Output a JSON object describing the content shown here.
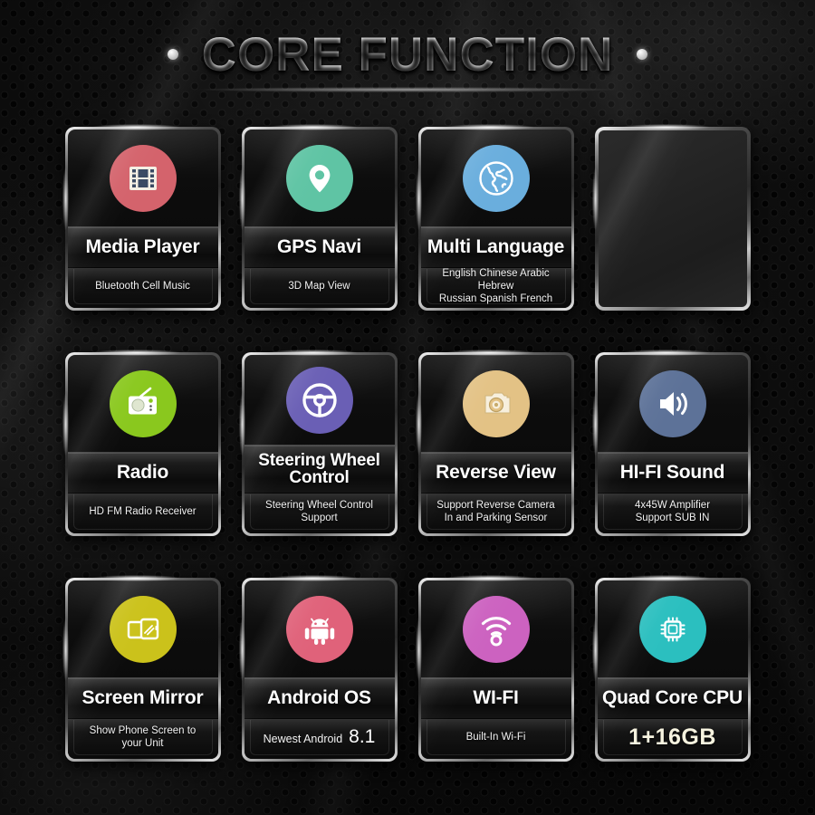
{
  "header": {
    "title": "CORE FUNCTION",
    "left_dot": "dot-decoration",
    "right_dot": "dot-decoration"
  },
  "cards": [
    {
      "id": "media-player",
      "title": "Media Player",
      "subtitle": "Bluetooth Cell Music",
      "icon": "film-strip-icon",
      "icon_color": "#d4636c",
      "title_lines": 1,
      "empty": false
    },
    {
      "id": "gps-navi",
      "title": "GPS Navi",
      "subtitle": "3D Map View",
      "icon": "location-pin-icon",
      "icon_color": "#5fc4a4",
      "title_lines": 1,
      "empty": false
    },
    {
      "id": "multi-language",
      "title": "Multi Language",
      "subtitle": "English Chinese Arabic Hebrew\nRussian Spanish French",
      "icon": "globe-icon",
      "icon_color": "#6aaedd",
      "title_lines": 1,
      "empty": false
    },
    {
      "id": "blank-slot",
      "title": "",
      "subtitle": "",
      "icon": "",
      "icon_color": "#2b2b2b",
      "title_lines": 0,
      "empty": true
    },
    {
      "id": "radio",
      "title": "Radio",
      "subtitle": "HD FM Radio Receiver",
      "icon": "radio-icon",
      "icon_color": "#8ac81e",
      "title_lines": 1,
      "empty": false
    },
    {
      "id": "steering-wheel-control",
      "title": "Steering Wheel\nControl",
      "subtitle": "Steering Wheel Control\nSupport",
      "icon": "steering-wheel-icon",
      "icon_color": "#6a5fb5",
      "title_lines": 2,
      "empty": false
    },
    {
      "id": "reverse-view",
      "title": "Reverse View",
      "subtitle": "Support Reverse Camera\nIn and Parking Sensor",
      "icon": "camera-icon",
      "icon_color": "#e3c285",
      "title_lines": 1,
      "empty": false
    },
    {
      "id": "hi-fi-sound",
      "title": "HI-FI Sound",
      "subtitle": "4x45W Amplifier\nSupport SUB IN",
      "icon": "speaker-icon",
      "icon_color": "#5d7298",
      "title_lines": 1,
      "empty": false
    },
    {
      "id": "screen-mirror",
      "title": "Screen Mirror",
      "subtitle": "Show Phone Screen to\nyour Unit",
      "icon": "screen-mirror-icon",
      "icon_color": "#cbc21b",
      "title_lines": 1,
      "empty": false
    },
    {
      "id": "android-os",
      "title": "Android OS",
      "subtitle": "Newest Android 8.1",
      "subtitle_part_1": "Newest Android",
      "subtitle_part_2": "8.1",
      "icon": "android-robot-icon",
      "icon_color": "#e0627a",
      "title_lines": 1,
      "empty": false
    },
    {
      "id": "wi-fi",
      "title": "WI-FI",
      "subtitle": "Built-In Wi-Fi",
      "icon": "wifi-signal-icon",
      "icon_color": "#cc62c0",
      "title_lines": 1,
      "empty": false
    },
    {
      "id": "quad-core-cpu",
      "title": "Quad Core CPU",
      "subtitle": "1+16GB",
      "icon": "cpu-chip-icon",
      "icon_color": "#2bbfbf",
      "title_lines": 1,
      "empty": false
    }
  ],
  "colors": {
    "background": "#0a0a0a",
    "card_border": "#c8c8c8",
    "title_text": "#ffffff",
    "accent_cream": "#f6f3df"
  }
}
